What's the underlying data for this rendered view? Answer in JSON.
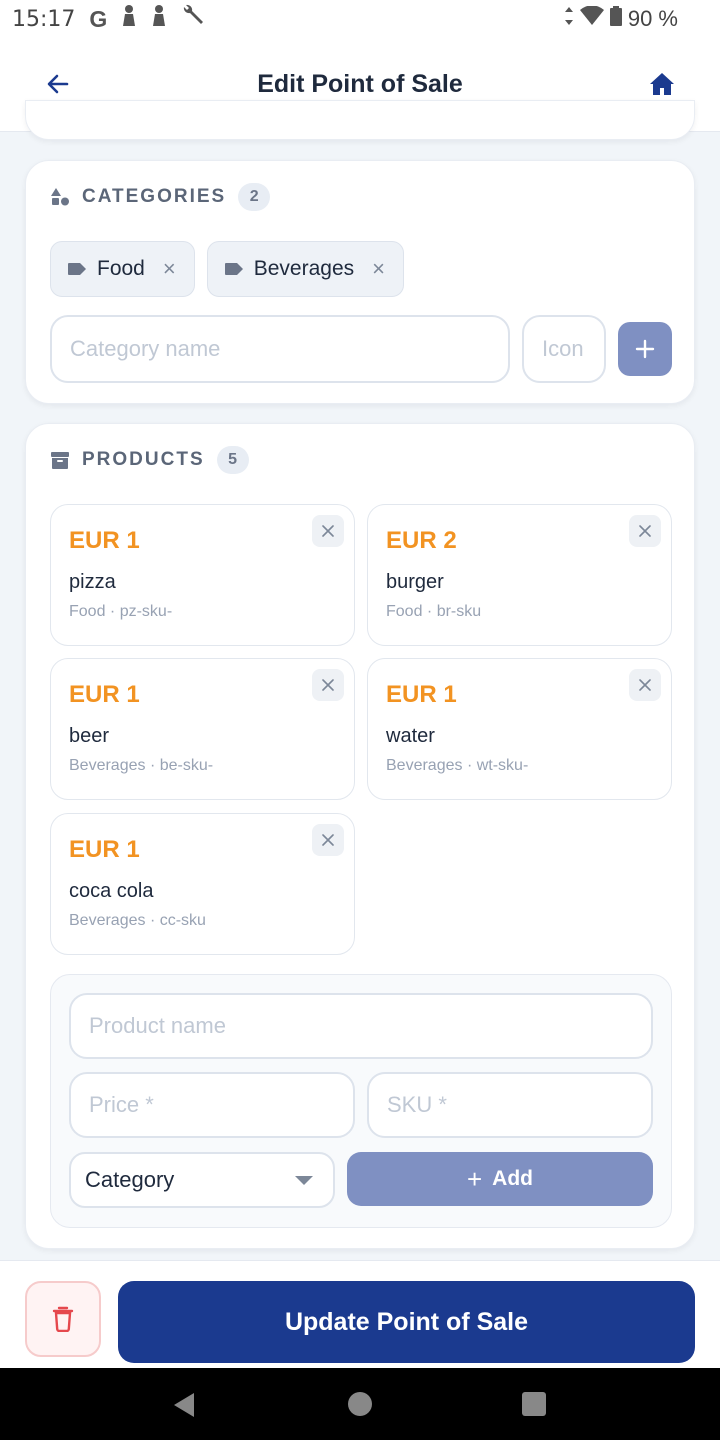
{
  "status_bar": {
    "time": "15:17",
    "g_label": "G",
    "battery": "90 %"
  },
  "header": {
    "title": "Edit Point of Sale",
    "back_icon": "arrow-left-icon",
    "home_icon": "home-icon"
  },
  "categories": {
    "title": "CATEGORIES",
    "count": "2",
    "chips": [
      {
        "label": "Food",
        "remove": "×"
      },
      {
        "label": "Beverages",
        "remove": "×"
      }
    ],
    "name_placeholder": "Category name",
    "icon_placeholder": "Icon",
    "add_symbol": "+"
  },
  "products": {
    "title": "PRODUCTS",
    "count": "5",
    "items": [
      {
        "price": "EUR 1",
        "name": "pizza",
        "meta": "Food · pz-sku-"
      },
      {
        "price": "EUR 2",
        "name": "burger",
        "meta": "Food · br-sku"
      },
      {
        "price": "EUR 1",
        "name": "beer",
        "meta": "Beverages · be-sku-"
      },
      {
        "price": "EUR 1",
        "name": "water",
        "meta": "Beverages · wt-sku-"
      },
      {
        "price": "EUR 1",
        "name": "coca cola",
        "meta": "Beverages · cc-sku"
      }
    ],
    "form": {
      "name_placeholder": "Product name",
      "price_placeholder": "Price *",
      "sku_placeholder": "SKU *",
      "category_label": "Category",
      "add_label": "Add",
      "add_symbol": "+"
    }
  },
  "footer": {
    "update_label": "Update Point of Sale",
    "delete_icon": "trash-icon"
  },
  "colors": {
    "primary": "#1b3a8f",
    "price": "#f29322",
    "muted_button": "#7f90c2",
    "danger": "#e5484d"
  }
}
